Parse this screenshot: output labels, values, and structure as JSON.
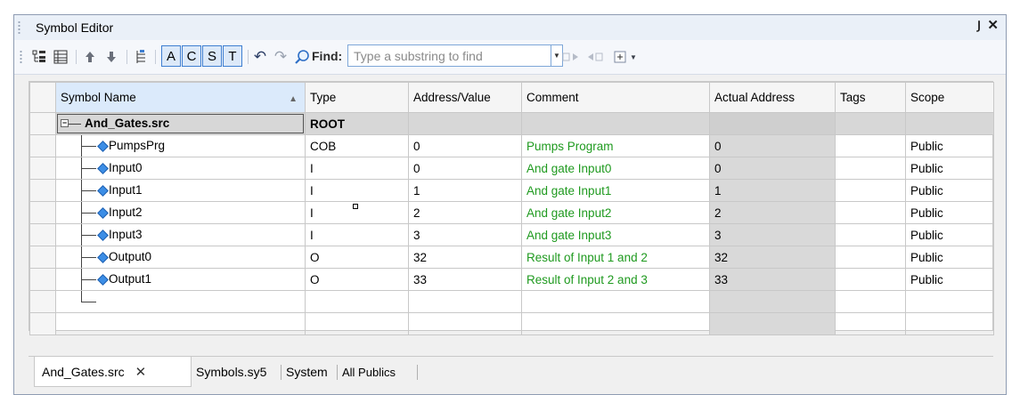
{
  "window": {
    "title": "Symbol Editor",
    "pin_label": "p",
    "close_label": "✕"
  },
  "toolbar": {
    "toggle_a": "A",
    "toggle_c": "C",
    "toggle_s": "S",
    "toggle_t": "T",
    "find_label": "Find:",
    "find_placeholder": "Type a substring to find",
    "find_value": ""
  },
  "columns": [
    "Symbol Name",
    "Type",
    "Address/Value",
    "Comment",
    "Actual Address",
    "Tags",
    "Scope"
  ],
  "root_row": {
    "name": "And_Gates.src",
    "type": "ROOT"
  },
  "rows": [
    {
      "name": "PumpsPrg",
      "type": "COB",
      "address": "0",
      "comment": "Pumps Program",
      "actual": "0",
      "tags": "",
      "scope": "Public"
    },
    {
      "name": "Input0",
      "type": "I",
      "address": "0",
      "comment": "And gate Input0",
      "actual": "0",
      "tags": "",
      "scope": "Public"
    },
    {
      "name": "Input1",
      "type": "I",
      "address": "1",
      "comment": "And gate Input1",
      "actual": "1",
      "tags": "",
      "scope": "Public"
    },
    {
      "name": "Input2",
      "type": "I",
      "address": "2",
      "comment": "And gate Input2",
      "actual": "2",
      "tags": "",
      "scope": "Public"
    },
    {
      "name": "Input3",
      "type": "I",
      "address": "3",
      "comment": "And gate Input3",
      "actual": "3",
      "tags": "",
      "scope": "Public"
    },
    {
      "name": "Output0",
      "type": "O",
      "address": "32",
      "comment": "Result of Input 1 and 2",
      "actual": "32",
      "tags": "",
      "scope": "Public"
    },
    {
      "name": "Output1",
      "type": "O",
      "address": "33",
      "comment": "Result of Input 2 and 3",
      "actual": "33",
      "tags": "",
      "scope": "Public"
    }
  ],
  "tabs": [
    {
      "label": "And_Gates.src",
      "active": true,
      "close": "✕"
    },
    {
      "label": "Symbols.sy5"
    },
    {
      "label": "System"
    },
    {
      "label": "All Publics"
    }
  ],
  "colors": {
    "comment": "#1f9a1f",
    "accent": "#3f7fd1",
    "symbol_icon": "#3c8ee6"
  }
}
